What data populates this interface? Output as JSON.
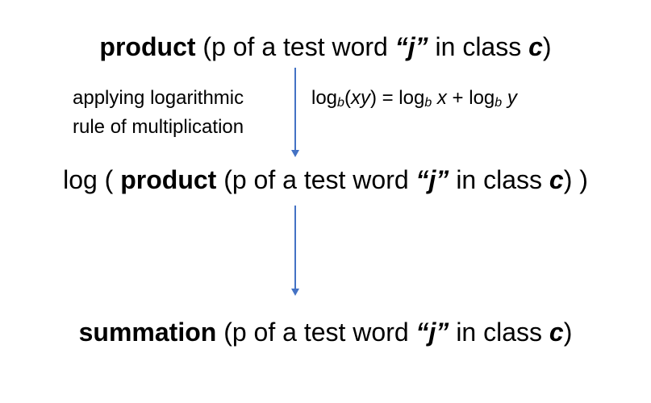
{
  "diagram": {
    "step1": {
      "bold_word": "product",
      "rest_before_j": "(p of a test word ",
      "j": "“j”",
      "in_class": " in class ",
      "c": "c",
      "close": ")"
    },
    "annotation": {
      "line1": "applying logarithmic",
      "line2": "rule of multiplication",
      "rule": {
        "log1": "log",
        "b1": "b",
        "arg_open": "(",
        "xy": "xy",
        "arg_close": ") = log",
        "b2": "b",
        "x": " x",
        "plus": " + log",
        "b3": "b",
        "y": " y"
      }
    },
    "step2": {
      "prefix": "log ( ",
      "bold_word": "product",
      "rest_before_j": " (p of a test word ",
      "j": "“j”",
      "in_class": " in class ",
      "c": "c",
      "close": ") )"
    },
    "step3": {
      "bold_word": "summation",
      "rest_before_j": " (p of a test word ",
      "j": "“j”",
      "in_class": " in class ",
      "c": "c",
      "close": ")"
    },
    "arrow_color": "#4472C4"
  }
}
